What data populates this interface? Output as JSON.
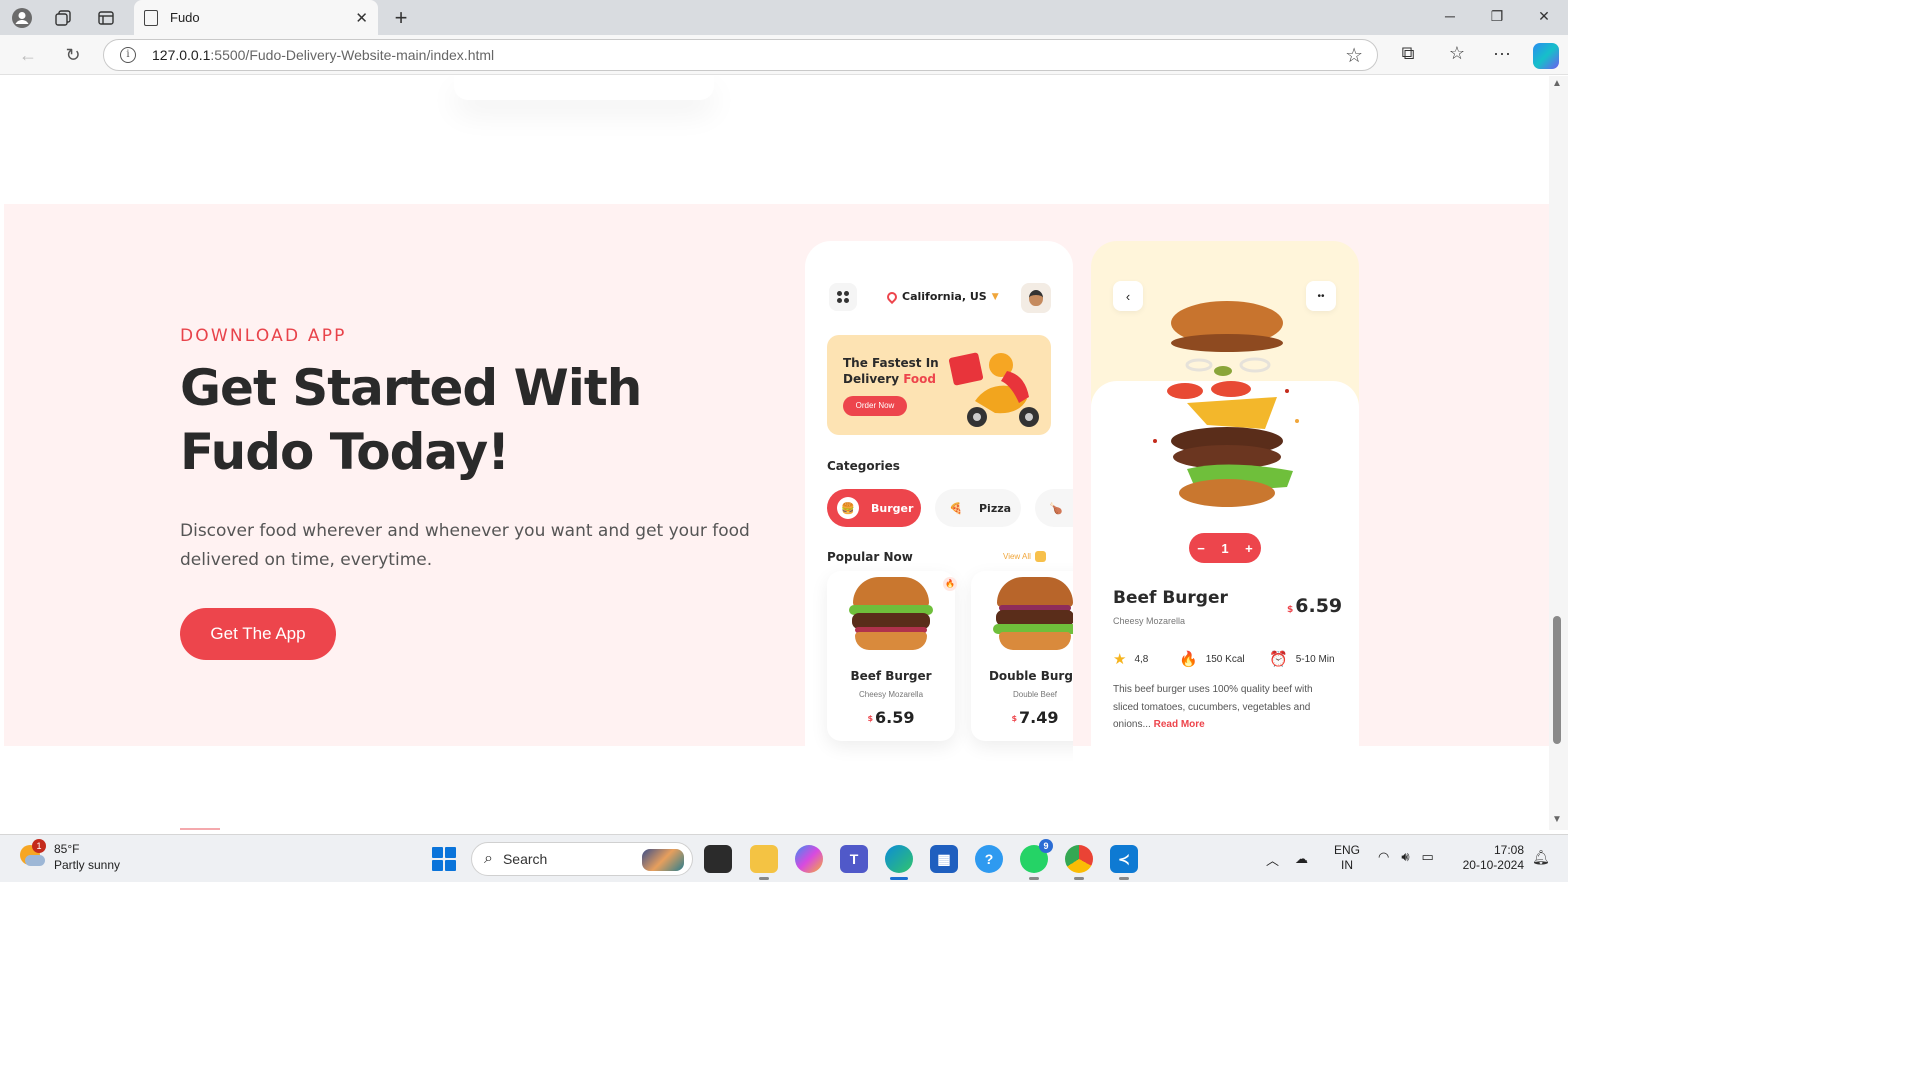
{
  "browser": {
    "tab_title": "Fudo",
    "url_host": "127.0.0.1",
    "url_path": ":5500/Fudo-Delivery-Website-main/index.html"
  },
  "hero": {
    "label": "DOWNLOAD APP",
    "heading": "Get Started With Fudo Today!",
    "description": "Discover food wherever and whenever you want and get your food delivered on time, everytime.",
    "cta": "Get The App"
  },
  "phone1": {
    "location": "California, US",
    "banner_line1": "The Fastest In",
    "banner_line2": "Delivery",
    "banner_accent": "Food",
    "banner_button": "Order Now",
    "categories_title": "Categories",
    "categories": [
      "Burger",
      "Pizza"
    ],
    "popular_title": "Popular Now",
    "view_all": "View All",
    "items": [
      {
        "name": "Beef Burger",
        "sub": "Cheesy Mozarella",
        "currency": "$",
        "price": "6.59"
      },
      {
        "name": "Double Burge",
        "sub": "Double Beef",
        "currency": "$",
        "price": "7.49"
      }
    ]
  },
  "phone2": {
    "quantity": "1",
    "name": "Beef Burger",
    "sub": "Cheesy Mozarella",
    "currency": "$",
    "price": "6.59",
    "rating": "4,8",
    "kcal": "150 Kcal",
    "time": "5-10 Min",
    "description": "This beef burger uses 100% quality beef with sliced tomatoes, cucumbers, vegetables and onions...",
    "read_more": "Read More"
  },
  "taskbar": {
    "weather_temp": "85°F",
    "weather_desc": "Partly sunny",
    "weather_badge": "1",
    "search": "Search",
    "whatsapp_badge": "9",
    "lang1": "ENG",
    "lang2": "IN",
    "time": "17:08",
    "date": "20-10-2024"
  },
  "colors": {
    "accent": "#ed454c",
    "section_bg": "#fff2f2",
    "banner_bg": "#fde3b3",
    "highlight": "#f0a63b"
  }
}
